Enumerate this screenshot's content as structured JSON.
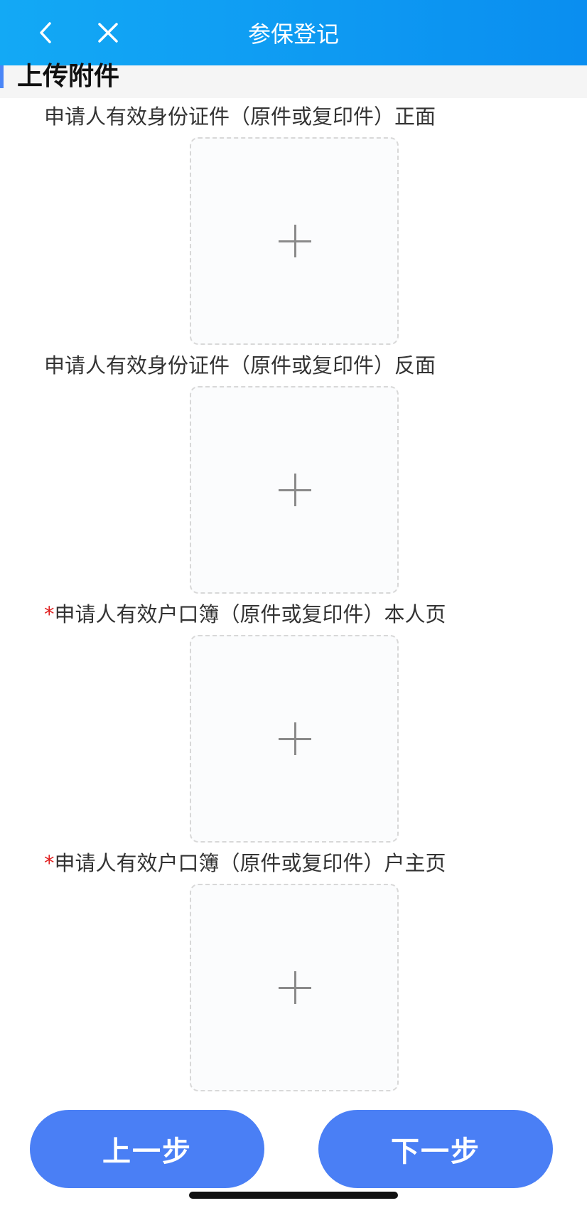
{
  "header": {
    "title": "参保登记",
    "back_icon": "chevron-left-icon",
    "close_icon": "close-icon"
  },
  "section": {
    "title": "上传附件",
    "accent_color": "#4a86f7"
  },
  "uploads": [
    {
      "required": false,
      "label": "申请人有效身份证件（原件或复印件）正面"
    },
    {
      "required": false,
      "label": "申请人有效身份证件（原件或复印件）反面"
    },
    {
      "required": true,
      "label": "申请人有效户口簿（原件或复印件）本人页"
    },
    {
      "required": true,
      "label": "申请人有效户口簿（原件或复印件）户主页"
    }
  ],
  "required_mark": "*",
  "buttons": {
    "prev": "上一步",
    "next": "下一步"
  },
  "colors": {
    "header": "#0a8ef0",
    "button": "#4a7ff5",
    "required": "#e02020"
  }
}
